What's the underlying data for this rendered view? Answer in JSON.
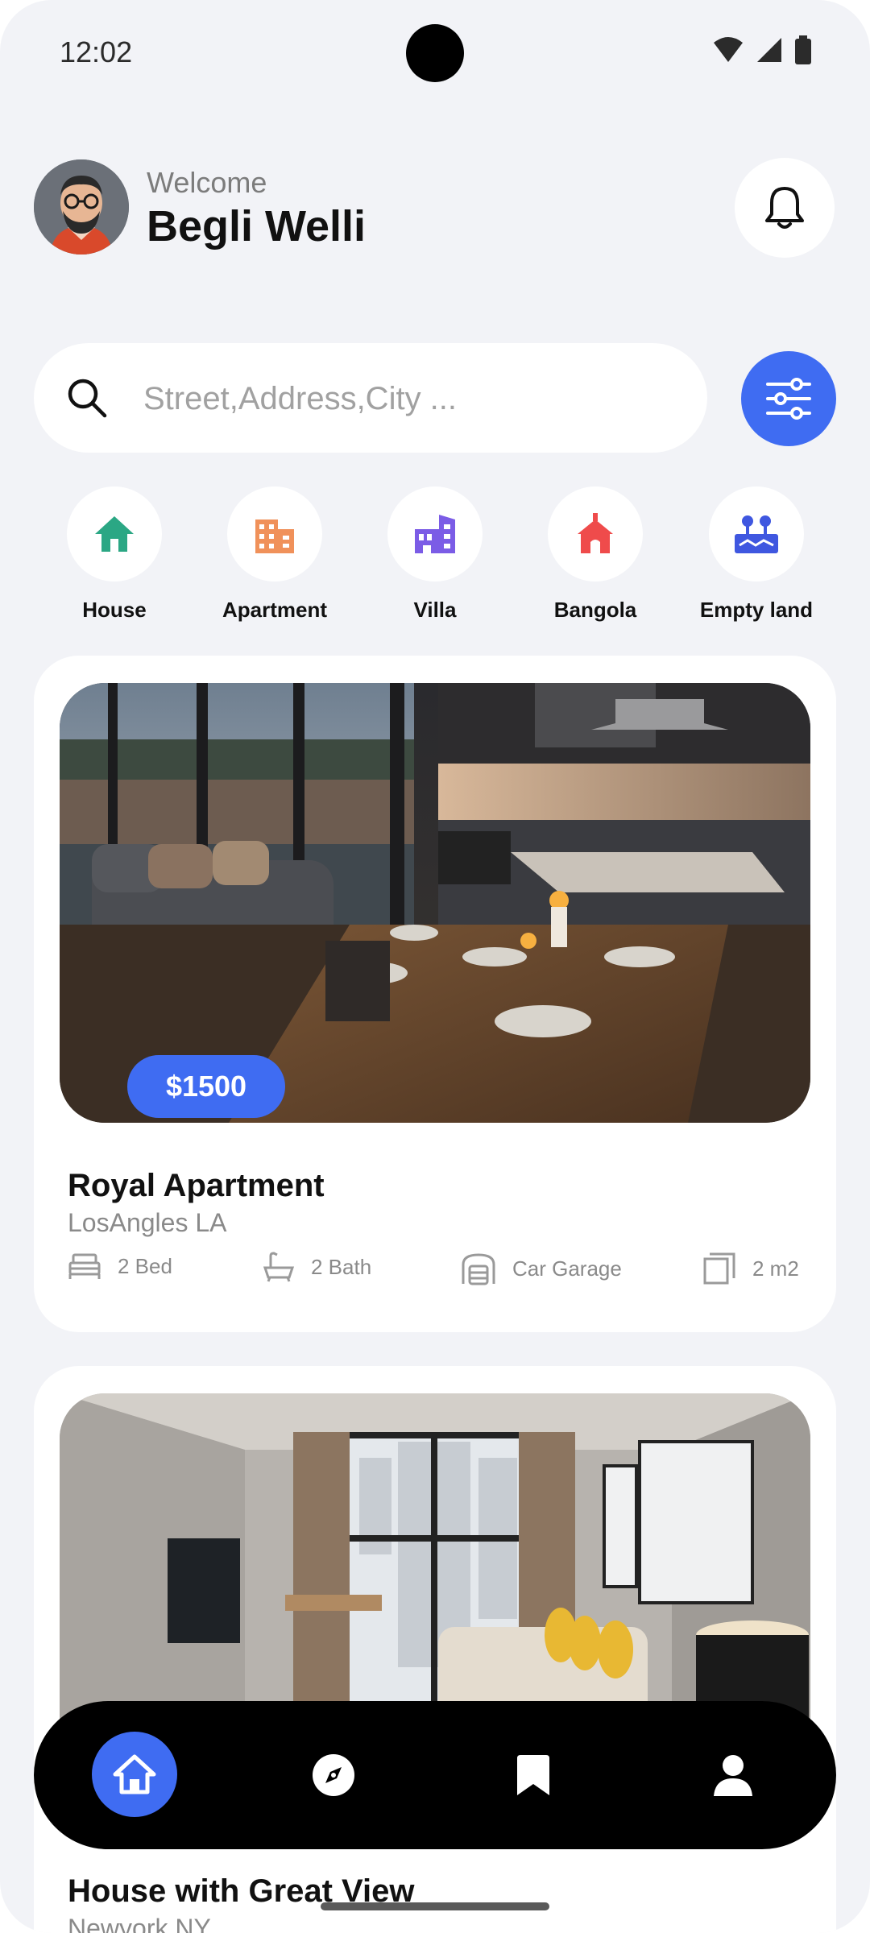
{
  "status": {
    "time": "12:02"
  },
  "header": {
    "welcome": "Welcome",
    "username": "Begli Welli"
  },
  "search": {
    "placeholder": "Street,Address,City ..."
  },
  "categories": [
    {
      "label": "House",
      "icon": "house-icon",
      "color": "#2BA784"
    },
    {
      "label": "Apartment",
      "icon": "apartment-icon",
      "color": "#F0915A"
    },
    {
      "label": "Villa",
      "icon": "villa-icon",
      "color": "#7B5CE6"
    },
    {
      "label": "Bangola",
      "icon": "bungalow-icon",
      "color": "#EF4B4B"
    },
    {
      "label": "Empty land",
      "icon": "land-icon",
      "color": "#3F57E0"
    }
  ],
  "listings": [
    {
      "price": "$1500",
      "title": "Royal Apartment",
      "location": "LosAngles LA",
      "features": [
        {
          "icon": "bed-icon",
          "label": "2 Bed"
        },
        {
          "icon": "bath-icon",
          "label": "2 Bath"
        },
        {
          "icon": "garage-icon",
          "label": "Car Garage"
        },
        {
          "icon": "area-icon",
          "label": "2 m2"
        }
      ]
    },
    {
      "title": "House with Great View",
      "location": "Newyork NY"
    }
  ],
  "nav": [
    {
      "icon": "home-icon",
      "active": true
    },
    {
      "icon": "compass-icon",
      "active": false
    },
    {
      "icon": "bookmark-icon",
      "active": false
    },
    {
      "icon": "profile-icon",
      "active": false
    }
  ],
  "colors": {
    "accent": "#3F6CF2",
    "background": "#F2F3F7",
    "nav": "#000000"
  }
}
